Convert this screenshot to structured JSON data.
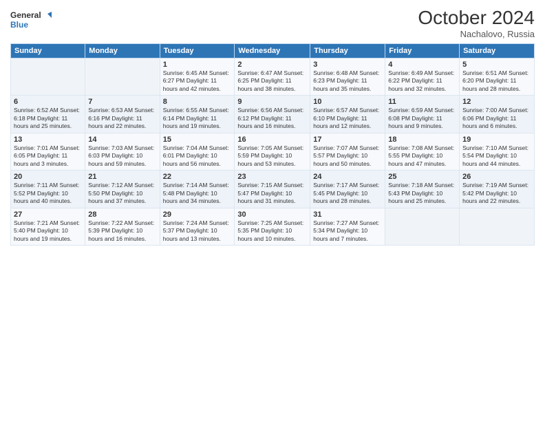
{
  "logo": {
    "line1": "General",
    "line2": "Blue"
  },
  "title": "October 2024",
  "location": "Nachalovo, Russia",
  "headers": [
    "Sunday",
    "Monday",
    "Tuesday",
    "Wednesday",
    "Thursday",
    "Friday",
    "Saturday"
  ],
  "weeks": [
    [
      {
        "day": "",
        "info": ""
      },
      {
        "day": "",
        "info": ""
      },
      {
        "day": "1",
        "info": "Sunrise: 6:45 AM\nSunset: 6:27 PM\nDaylight: 11 hours and 42 minutes."
      },
      {
        "day": "2",
        "info": "Sunrise: 6:47 AM\nSunset: 6:25 PM\nDaylight: 11 hours and 38 minutes."
      },
      {
        "day": "3",
        "info": "Sunrise: 6:48 AM\nSunset: 6:23 PM\nDaylight: 11 hours and 35 minutes."
      },
      {
        "day": "4",
        "info": "Sunrise: 6:49 AM\nSunset: 6:22 PM\nDaylight: 11 hours and 32 minutes."
      },
      {
        "day": "5",
        "info": "Sunrise: 6:51 AM\nSunset: 6:20 PM\nDaylight: 11 hours and 28 minutes."
      }
    ],
    [
      {
        "day": "6",
        "info": "Sunrise: 6:52 AM\nSunset: 6:18 PM\nDaylight: 11 hours and 25 minutes."
      },
      {
        "day": "7",
        "info": "Sunrise: 6:53 AM\nSunset: 6:16 PM\nDaylight: 11 hours and 22 minutes."
      },
      {
        "day": "8",
        "info": "Sunrise: 6:55 AM\nSunset: 6:14 PM\nDaylight: 11 hours and 19 minutes."
      },
      {
        "day": "9",
        "info": "Sunrise: 6:56 AM\nSunset: 6:12 PM\nDaylight: 11 hours and 16 minutes."
      },
      {
        "day": "10",
        "info": "Sunrise: 6:57 AM\nSunset: 6:10 PM\nDaylight: 11 hours and 12 minutes."
      },
      {
        "day": "11",
        "info": "Sunrise: 6:59 AM\nSunset: 6:08 PM\nDaylight: 11 hours and 9 minutes."
      },
      {
        "day": "12",
        "info": "Sunrise: 7:00 AM\nSunset: 6:06 PM\nDaylight: 11 hours and 6 minutes."
      }
    ],
    [
      {
        "day": "13",
        "info": "Sunrise: 7:01 AM\nSunset: 6:05 PM\nDaylight: 11 hours and 3 minutes."
      },
      {
        "day": "14",
        "info": "Sunrise: 7:03 AM\nSunset: 6:03 PM\nDaylight: 10 hours and 59 minutes."
      },
      {
        "day": "15",
        "info": "Sunrise: 7:04 AM\nSunset: 6:01 PM\nDaylight: 10 hours and 56 minutes."
      },
      {
        "day": "16",
        "info": "Sunrise: 7:05 AM\nSunset: 5:59 PM\nDaylight: 10 hours and 53 minutes."
      },
      {
        "day": "17",
        "info": "Sunrise: 7:07 AM\nSunset: 5:57 PM\nDaylight: 10 hours and 50 minutes."
      },
      {
        "day": "18",
        "info": "Sunrise: 7:08 AM\nSunset: 5:55 PM\nDaylight: 10 hours and 47 minutes."
      },
      {
        "day": "19",
        "info": "Sunrise: 7:10 AM\nSunset: 5:54 PM\nDaylight: 10 hours and 44 minutes."
      }
    ],
    [
      {
        "day": "20",
        "info": "Sunrise: 7:11 AM\nSunset: 5:52 PM\nDaylight: 10 hours and 40 minutes."
      },
      {
        "day": "21",
        "info": "Sunrise: 7:12 AM\nSunset: 5:50 PM\nDaylight: 10 hours and 37 minutes."
      },
      {
        "day": "22",
        "info": "Sunrise: 7:14 AM\nSunset: 5:48 PM\nDaylight: 10 hours and 34 minutes."
      },
      {
        "day": "23",
        "info": "Sunrise: 7:15 AM\nSunset: 5:47 PM\nDaylight: 10 hours and 31 minutes."
      },
      {
        "day": "24",
        "info": "Sunrise: 7:17 AM\nSunset: 5:45 PM\nDaylight: 10 hours and 28 minutes."
      },
      {
        "day": "25",
        "info": "Sunrise: 7:18 AM\nSunset: 5:43 PM\nDaylight: 10 hours and 25 minutes."
      },
      {
        "day": "26",
        "info": "Sunrise: 7:19 AM\nSunset: 5:42 PM\nDaylight: 10 hours and 22 minutes."
      }
    ],
    [
      {
        "day": "27",
        "info": "Sunrise: 7:21 AM\nSunset: 5:40 PM\nDaylight: 10 hours and 19 minutes."
      },
      {
        "day": "28",
        "info": "Sunrise: 7:22 AM\nSunset: 5:39 PM\nDaylight: 10 hours and 16 minutes."
      },
      {
        "day": "29",
        "info": "Sunrise: 7:24 AM\nSunset: 5:37 PM\nDaylight: 10 hours and 13 minutes."
      },
      {
        "day": "30",
        "info": "Sunrise: 7:25 AM\nSunset: 5:35 PM\nDaylight: 10 hours and 10 minutes."
      },
      {
        "day": "31",
        "info": "Sunrise: 7:27 AM\nSunset: 5:34 PM\nDaylight: 10 hours and 7 minutes."
      },
      {
        "day": "",
        "info": ""
      },
      {
        "day": "",
        "info": ""
      }
    ]
  ]
}
